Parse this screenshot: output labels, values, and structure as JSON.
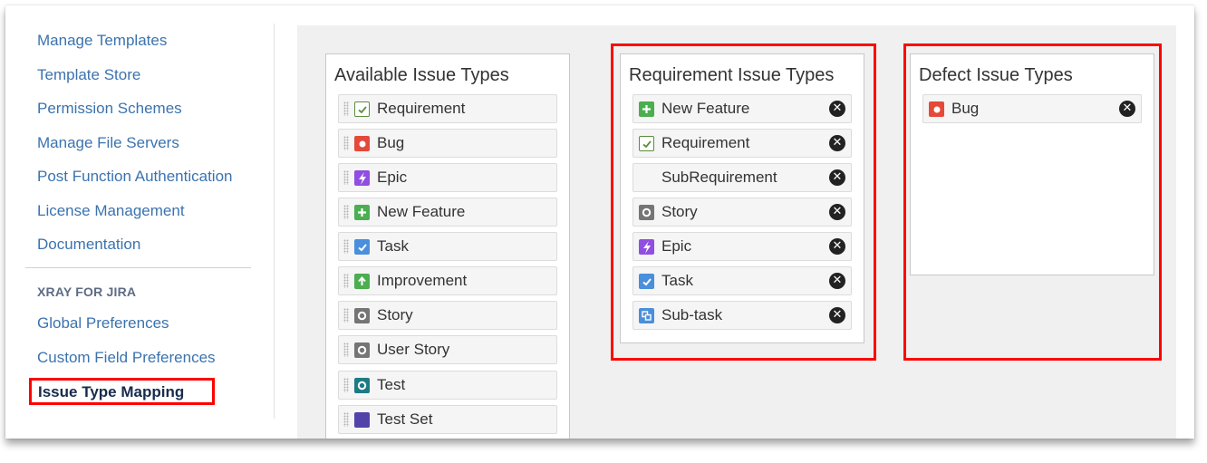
{
  "sidebar": {
    "links": [
      {
        "label": "Manage Templates"
      },
      {
        "label": "Template Store"
      },
      {
        "label": "Permission Schemes"
      },
      {
        "label": "Manage File Servers"
      },
      {
        "label": "Post Function Authentication"
      },
      {
        "label": "License Management"
      },
      {
        "label": "Documentation"
      }
    ],
    "section_heading": "XRAY FOR JIRA",
    "section_links": [
      {
        "label": "Global Preferences"
      },
      {
        "label": "Custom Field Preferences"
      }
    ],
    "active_link": "Issue Type Mapping"
  },
  "available": {
    "title": "Available Issue Types",
    "items": [
      {
        "label": "Requirement",
        "icon": "requirement-icon"
      },
      {
        "label": "Bug",
        "icon": "bug-icon"
      },
      {
        "label": "Epic",
        "icon": "epic-icon"
      },
      {
        "label": "New Feature",
        "icon": "new-feature-icon"
      },
      {
        "label": "Task",
        "icon": "task-icon"
      },
      {
        "label": "Improvement",
        "icon": "improvement-icon"
      },
      {
        "label": "Story",
        "icon": "story-icon"
      },
      {
        "label": "User Story",
        "icon": "story-icon"
      },
      {
        "label": "Test",
        "icon": "test-icon"
      },
      {
        "label": "Test Set",
        "icon": "test-set-icon"
      }
    ]
  },
  "requirement": {
    "title": "Requirement Issue Types",
    "items": [
      {
        "label": "New Feature",
        "icon": "new-feature-icon"
      },
      {
        "label": "Requirement",
        "icon": "requirement-icon"
      },
      {
        "label": "SubRequirement",
        "icon": "none"
      },
      {
        "label": "Story",
        "icon": "story-icon"
      },
      {
        "label": "Epic",
        "icon": "epic-icon"
      },
      {
        "label": "Task",
        "icon": "task-icon"
      },
      {
        "label": "Sub-task",
        "icon": "subtask-icon"
      }
    ]
  },
  "defect": {
    "title": "Defect Issue Types",
    "items": [
      {
        "label": "Bug",
        "icon": "bug-icon"
      }
    ]
  },
  "colors": {
    "link": "#3b73af",
    "highlight": "#ff0000",
    "panel_bg": "#f0f0f0",
    "bug": "#e5493a",
    "epic": "#904ee2",
    "feature": "#4bae4f",
    "task": "#4a8fdb",
    "story": "#757575",
    "test": "#1e7b84"
  }
}
